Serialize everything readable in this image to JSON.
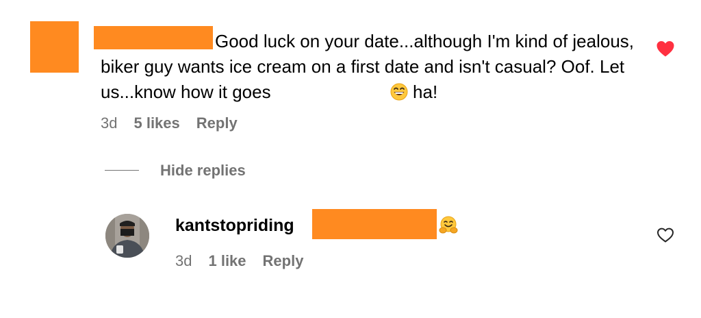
{
  "comment": {
    "text_before_emoji": "Good luck on your date...although I'm kind of jealous, biker guy wants ice cream on a first date and isn't casual? Oof. Let us...know how it goes ",
    "emoji_icon": "grinning-face-icon",
    "text_after_emoji": " ha!",
    "age": "3d",
    "likes": "5 likes",
    "reply_label": "Reply",
    "liked": true
  },
  "hide_replies_label": "Hide replies",
  "reply": {
    "username": "kantstopriding",
    "emoji_icon": "hugging-face-icon",
    "age": "3d",
    "likes": "1 like",
    "reply_label": "Reply",
    "liked": false
  },
  "colors": {
    "redaction": "#FF8A20",
    "meta_text": "#737373",
    "like_red": "#FF3040"
  }
}
